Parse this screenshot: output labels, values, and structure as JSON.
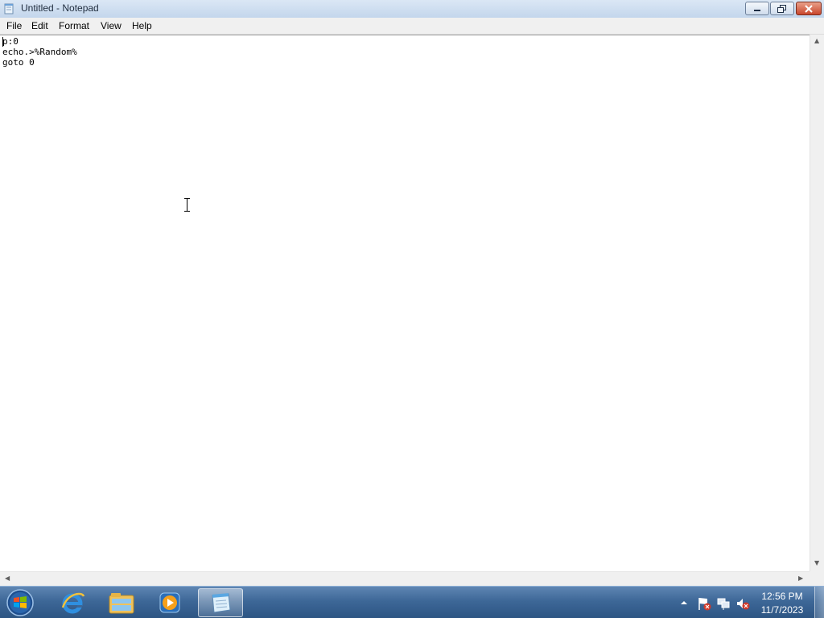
{
  "window": {
    "title": "Untitled - Notepad"
  },
  "menu": {
    "items": [
      "File",
      "Edit",
      "Format",
      "View",
      "Help"
    ]
  },
  "editor": {
    "lines": [
      "p:0",
      "echo.>%Random%",
      "goto 0"
    ]
  },
  "taskbar": {
    "pinned": [
      "start-orb-icon",
      "internet-explorer-icon",
      "windows-explorer-icon",
      "media-player-icon",
      "notepad-icon"
    ],
    "clock": {
      "time": "12:56 PM",
      "date": "11/7/2023"
    }
  },
  "colors": {
    "taskbar": "#3d6797",
    "close_button": "#c9462c",
    "titlebar": "#c3d6ec"
  }
}
